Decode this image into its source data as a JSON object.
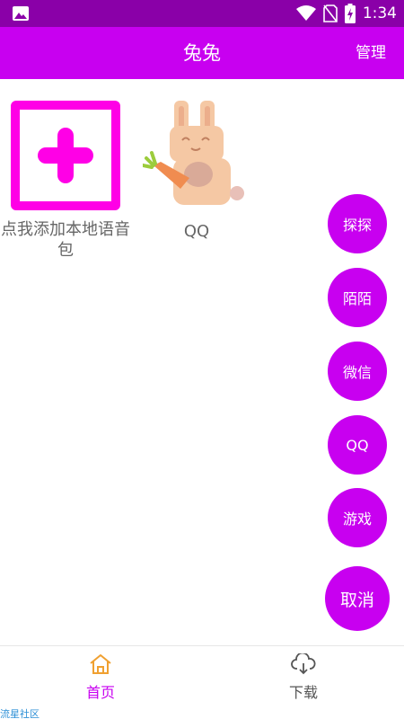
{
  "status_bar": {
    "time": "1:34",
    "icons": [
      "image-icon",
      "wifi-icon",
      "no-sim-icon",
      "battery-charging-icon"
    ]
  },
  "app_bar": {
    "title": "兔兔",
    "manage_label": "管理"
  },
  "grid": {
    "add_tile": {
      "label": "点我添加本地语音包",
      "icon": "plus-box-icon"
    },
    "qq_tile": {
      "label": "QQ",
      "icon": "bunny-carrot-icon"
    }
  },
  "fabs": {
    "explore": "探探",
    "momo": "陌陌",
    "wechat": "微信",
    "qq": "QQ",
    "games": "游戏",
    "cancel": "取消"
  },
  "tab_bar": {
    "home": {
      "label": "首页",
      "icon": "home-icon"
    },
    "download": {
      "label": "下载",
      "icon": "cloud-download-icon"
    }
  },
  "watermark": "流星社区",
  "colors": {
    "primary": "#c800f0",
    "status_bar": "#8a00a8",
    "accent_pink": "#ff00e6",
    "home_icon": "#f0a030"
  }
}
